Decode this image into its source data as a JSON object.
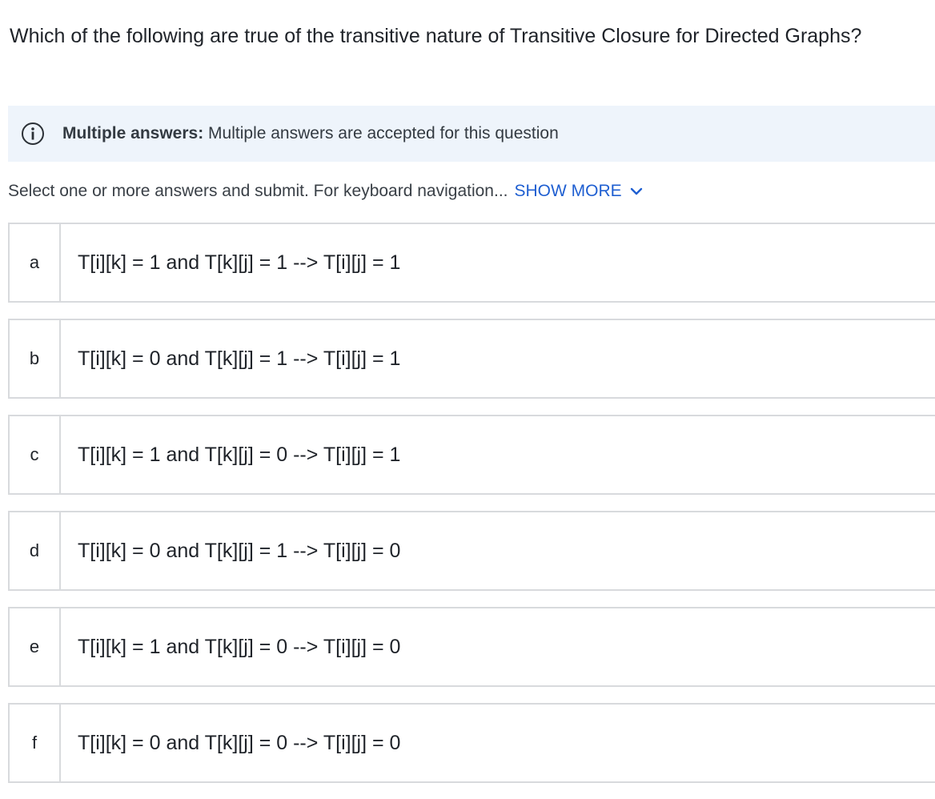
{
  "question": {
    "text": "Which of the following are true of the transitive nature of Transitive Closure for Directed Graphs?"
  },
  "info_banner": {
    "icon": "info-icon",
    "label": "Multiple answers:",
    "text": "Multiple answers are accepted for this question"
  },
  "instruction": {
    "text": "Select one or more answers and submit. For keyboard navigation...",
    "show_more_label": "SHOW MORE",
    "show_more_icon": "chevron-down-icon"
  },
  "answers": [
    {
      "letter": "a",
      "text": "T[i][k] = 1 and T[k][j] = 1 --> T[i][j] = 1"
    },
    {
      "letter": "b",
      "text": "T[i][k] = 0 and T[k][j] = 1 --> T[i][j] = 1"
    },
    {
      "letter": "c",
      "text": "T[i][k] = 1 and T[k][j] = 0 --> T[i][j] = 1"
    },
    {
      "letter": "d",
      "text": "T[i][k] = 0 and T[k][j] = 1 --> T[i][j] = 0"
    },
    {
      "letter": "e",
      "text": "T[i][k] = 1 and T[k][j] = 0 --> T[i][j] = 0"
    },
    {
      "letter": "f",
      "text": "T[i][k] = 0 and T[k][j] = 0 --> T[i][j] = 0"
    }
  ],
  "colors": {
    "banner_bg": "#eef4fb",
    "link": "#1f5fd1",
    "border": "#d8dadd",
    "text": "#1f2329"
  }
}
